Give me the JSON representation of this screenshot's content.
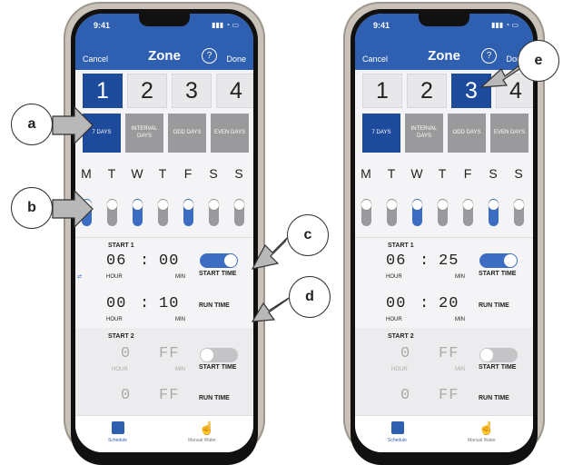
{
  "status_time": "9:41",
  "nav": {
    "cancel": "Cancel",
    "title": "Zone",
    "help": "?",
    "done": "Done"
  },
  "zones": [
    "1",
    "2",
    "3",
    "4"
  ],
  "modes": [
    "7 DAYS",
    "INTERVAL DAYS",
    "ODD DAYS",
    "EVEN DAYS"
  ],
  "days": [
    "M",
    "T",
    "W",
    "T",
    "F",
    "S",
    "S"
  ],
  "labels": {
    "start1": "START 1",
    "start2": "START 2",
    "hour": "HOUR",
    "min": "MIN",
    "start_time": "START TIME",
    "run_time": "RUN TIME",
    "colon": ":"
  },
  "tabs": {
    "schedule": "Schedule",
    "manual": "Manual Water"
  },
  "left": {
    "selected_zone": 1,
    "selected_mode": 0,
    "days_on": [
      true,
      false,
      true,
      false,
      true,
      false,
      false
    ],
    "start1": {
      "hour": "06",
      "min": "00",
      "run_hour": "00",
      "run_min": "10",
      "enabled": true
    },
    "start2": {
      "hour": "0",
      "min": "FF",
      "run_hour": "0",
      "run_min": "FF",
      "enabled": false
    }
  },
  "right": {
    "selected_zone": 3,
    "selected_mode": 0,
    "days_on": [
      false,
      false,
      true,
      false,
      false,
      true,
      false
    ],
    "start1": {
      "hour": "06",
      "min": "25",
      "run_hour": "00",
      "run_min": "20",
      "enabled": true
    },
    "start2": {
      "hour": "0",
      "min": "FF",
      "run_hour": "0",
      "run_min": "FF",
      "enabled": false
    }
  },
  "callouts": [
    "a",
    "b",
    "c",
    "d",
    "e"
  ]
}
